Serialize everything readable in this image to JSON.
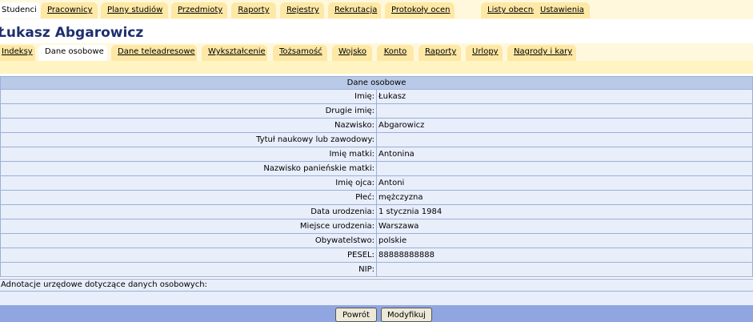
{
  "top_tabs": [
    {
      "label": "Studenci",
      "active": true
    },
    {
      "label": "Pracownicy"
    },
    {
      "label": "Plany studiów"
    },
    {
      "label": "Przedmioty"
    },
    {
      "label": "Raporty"
    },
    {
      "label": "Rejestry"
    },
    {
      "label": "Rekrutacja"
    },
    {
      "label": "Protokoły ocen"
    },
    {
      "label": "Listy obecności"
    },
    {
      "label": "Ustawienia"
    }
  ],
  "person_name": "Łukasz Abgarowicz",
  "sub_tabs": [
    {
      "label": "Indeksy"
    },
    {
      "label": "Dane osobowe",
      "active": true
    },
    {
      "label": "Dane teleadresowe"
    },
    {
      "label": "Wykształcenie"
    },
    {
      "label": "Tożsamość"
    },
    {
      "label": "Wojsko"
    },
    {
      "label": "Konto"
    },
    {
      "label": "Raporty"
    },
    {
      "label": "Urlopy"
    },
    {
      "label": "Nagrody i kary"
    }
  ],
  "section_title": "Dane osobowe",
  "fields": [
    {
      "label": "Imię:",
      "value": "Łukasz"
    },
    {
      "label": "Drugie imię:",
      "value": ""
    },
    {
      "label": "Nazwisko:",
      "value": "Abgarowicz"
    },
    {
      "label": "Tytuł naukowy lub zawodowy:",
      "value": ""
    },
    {
      "label": "Imię matki:",
      "value": "Antonina"
    },
    {
      "label": "Nazwisko panieńskie matki:",
      "value": ""
    },
    {
      "label": "Imię ojca:",
      "value": "Antoni"
    },
    {
      "label": "Płeć:",
      "value": "mężczyzna"
    },
    {
      "label": "Data urodzenia:",
      "value": "1 stycznia 1984"
    },
    {
      "label": "Miejsce urodzenia:",
      "value": "Warszawa"
    },
    {
      "label": "Obywatelstwo:",
      "value": "polskie"
    },
    {
      "label": "PESEL:",
      "value": "88888888888"
    },
    {
      "label": "NIP:",
      "value": ""
    }
  ],
  "notes_label": "Adnotacje urzędowe dotyczące danych osobowych:",
  "buttons": {
    "back": "Powrót",
    "modify": "Modyfikuj"
  },
  "colors": {
    "title": "#1d2f6e",
    "tab": "#fde8a5",
    "table_header": "#b9cae8",
    "table_row": "#e8eefa",
    "footer": "#8fa6e0"
  }
}
